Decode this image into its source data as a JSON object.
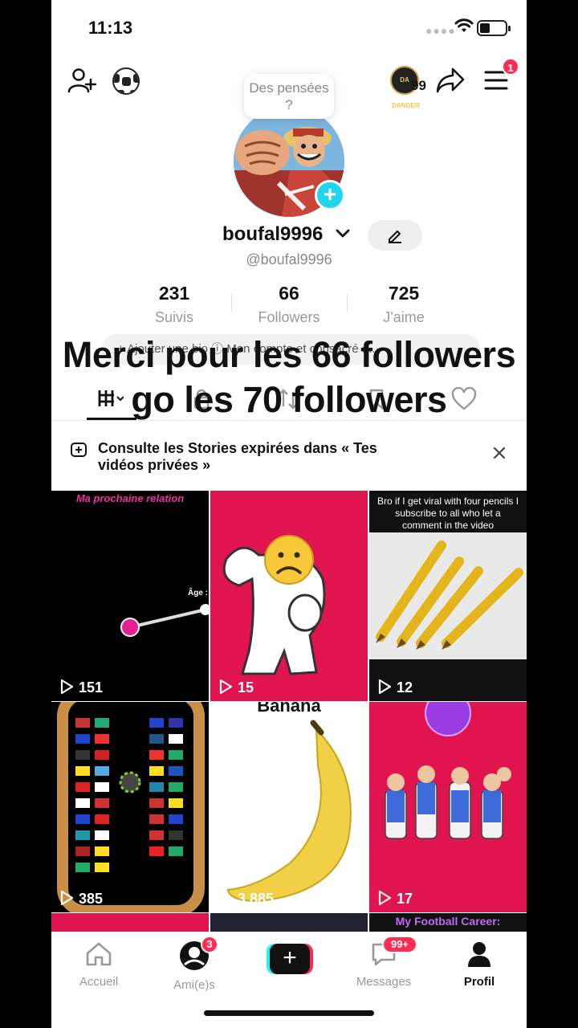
{
  "status": {
    "time": "11:13"
  },
  "header": {
    "add_friend_icon": "person-plus-icon",
    "soccer_icon": "soccer-ball-icon",
    "thought_bubble": "Des pensées ?",
    "avatar_badge": "99",
    "avatar_text": "DA DANGER",
    "menu_badge": "1"
  },
  "profile": {
    "username": "boufal9996",
    "handle": "@boufal9996",
    "stats": [
      {
        "value": "231",
        "label": "Suivis"
      },
      {
        "value": "66",
        "label": "Followers"
      },
      {
        "value": "725",
        "label": "J'aime"
      }
    ],
    "bio_button": "+ Ajouter une bio  ⓘ Mon compte et consacré à..."
  },
  "overlay_text": {
    "line1": "Merci pour les 66 followers",
    "line2": "go les 70 followers"
  },
  "stories_banner": {
    "text": "Consulte les Stories expirées dans « Tes vidéos privées »"
  },
  "videos": [
    {
      "caption": "Ma prochaine relation",
      "label": "Âge :",
      "views": "151"
    },
    {
      "caption": "",
      "views": "15"
    },
    {
      "caption": "Bro if I get viral with four pencils I subscribe to all who let a comment in the video",
      "views": "12"
    },
    {
      "caption": "",
      "views": "385"
    },
    {
      "caption": "Banana",
      "views": "3 885"
    },
    {
      "caption": "",
      "views": "17"
    }
  ],
  "partial_row": {
    "caption": "My Football Career:"
  },
  "nav": {
    "home": "Accueil",
    "friends": "Ami(e)s",
    "friends_badge": "3",
    "messages": "Messages",
    "messages_badge": "99+",
    "profile": "Profil"
  },
  "colors": {
    "accent": "#fe2c55",
    "cyan": "#25f4ee",
    "tile_pink": "#e0144e"
  }
}
